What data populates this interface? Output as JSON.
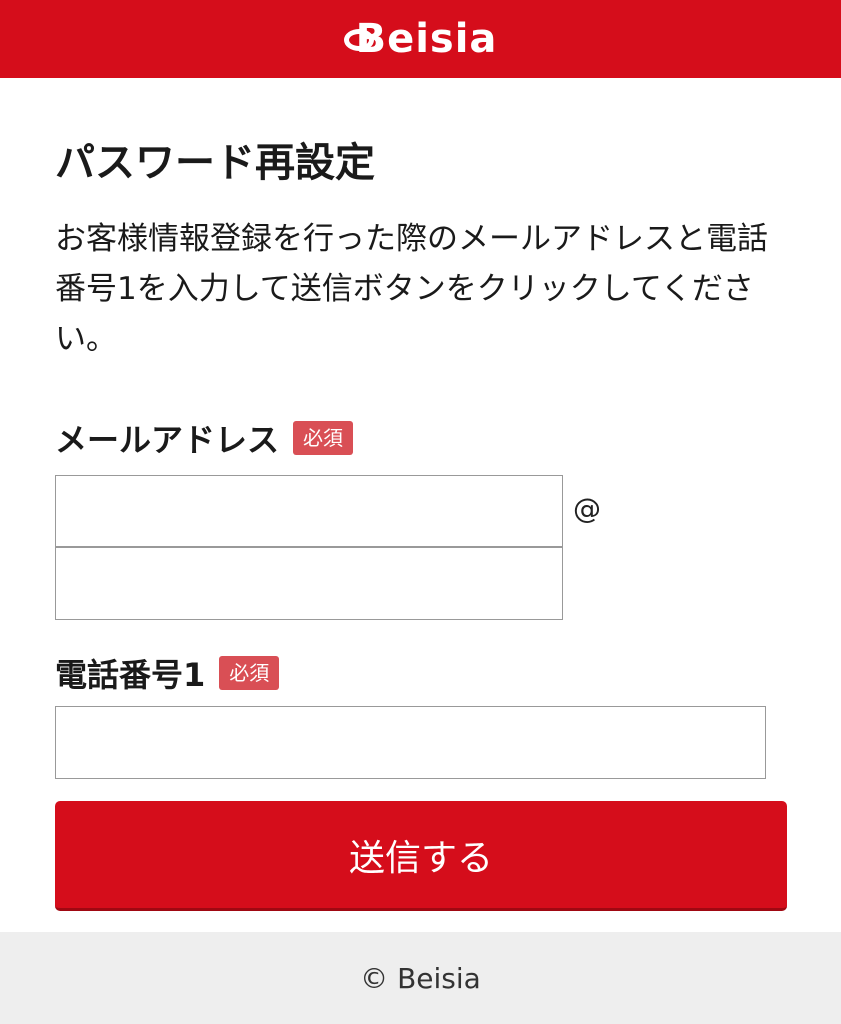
{
  "header": {
    "logo_text": "Beisia",
    "background_color": "#d50d1b"
  },
  "main": {
    "title": "パスワード再設定",
    "description": "お客様情報登録を行った際のメールアドレスと電話番号1を入力して送信ボタンをクリックしてください。"
  },
  "form": {
    "email": {
      "label": "メールアドレス",
      "required_badge": "必須",
      "local_value": "",
      "domain_value": "",
      "at_symbol": "@"
    },
    "phone": {
      "label": "電話番号1",
      "required_badge": "必須",
      "value": ""
    },
    "submit_label": "送信する",
    "accent_color": "#d50d1b",
    "badge_color": "#d94f55"
  },
  "footer": {
    "copyright": "© Beisia"
  }
}
